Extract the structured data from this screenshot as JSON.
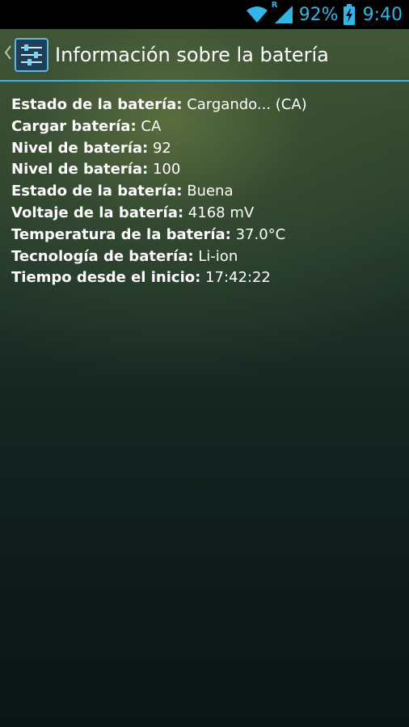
{
  "status_bar": {
    "battery_percent": "92%",
    "time": "9:40",
    "roaming_indicator": "R",
    "icons": [
      "wifi-icon",
      "signal-icon",
      "battery-charging-icon"
    ],
    "accent_color": "#33b5e5"
  },
  "action_bar": {
    "title": "Información sobre la batería",
    "up_icon": "chevron-left-icon",
    "app_icon": "settings-sliders-icon",
    "divider_color": "#33b5e5"
  },
  "battery_info": [
    {
      "label": "Estado de la batería:",
      "value": "Cargando... (CA)"
    },
    {
      "label": "Cargar batería:",
      "value": "CA"
    },
    {
      "label": "Nivel de batería:",
      "value": "92"
    },
    {
      "label": "Nivel de batería:",
      "value": "100"
    },
    {
      "label": "Estado de la batería:",
      "value": "Buena"
    },
    {
      "label": "Voltaje de la batería:",
      "value": "4168 mV"
    },
    {
      "label": "Temperatura de la batería:",
      "value": "37.0°C"
    },
    {
      "label": "Tecnología de batería:",
      "value": "Li-ion"
    },
    {
      "label": "Tiempo desde el inicio:",
      "value": "17:42:22"
    }
  ]
}
